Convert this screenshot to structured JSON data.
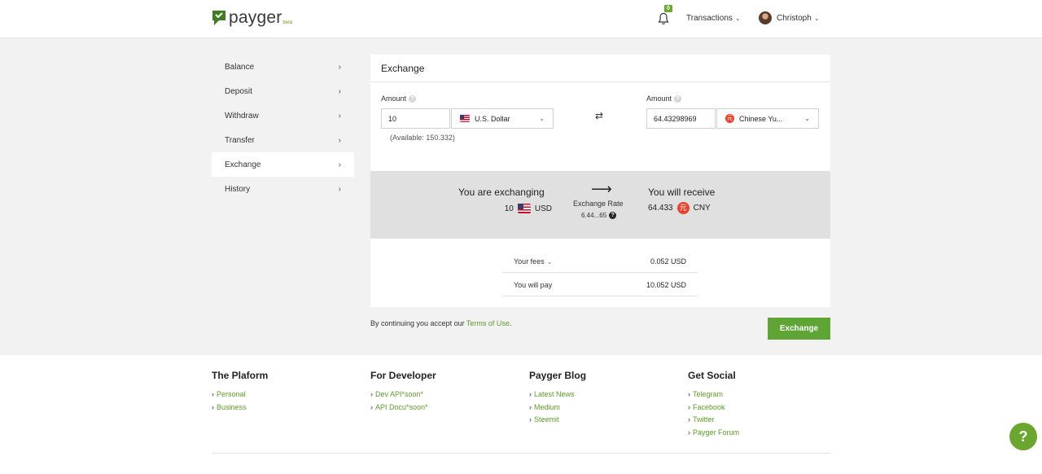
{
  "header": {
    "logo_text": "payger",
    "logo_beta": "beta",
    "notification_count": "0",
    "transactions_label": "Transactions",
    "user_name": "Christoph"
  },
  "sidebar": {
    "items": [
      {
        "label": "Balance"
      },
      {
        "label": "Deposit"
      },
      {
        "label": "Withdraw"
      },
      {
        "label": "Transfer"
      },
      {
        "label": "Exchange",
        "active": true
      },
      {
        "label": "History"
      }
    ]
  },
  "exchange": {
    "title": "Exchange",
    "from": {
      "amount_label": "Amount",
      "amount_value": "10",
      "currency": "U.S. Dollar",
      "available": "(Available: 150.332)"
    },
    "to": {
      "amount_label": "Amount",
      "amount_value": "64.43298969",
      "currency": "Chinese Yu..."
    },
    "summary": {
      "exchanging_title": "You are exchanging",
      "exchanging_amount": "10",
      "exchanging_code": "USD",
      "rate_label": "Exchange Rate",
      "rate_value": "6.44...65",
      "receive_title": "You will receive",
      "receive_amount": "64.433",
      "receive_code": "CNY"
    },
    "fees": {
      "fees_label": "Your fees",
      "fees_value": "0.052 USD",
      "pay_label": "You will pay",
      "pay_value": "10.052 USD"
    },
    "terms_prefix": "By continuing you accept our",
    "terms_link": "Terms of Use",
    "terms_suffix": ".",
    "button_label": "Exchange"
  },
  "footer": {
    "columns": [
      {
        "title": "The Plaform",
        "links": [
          "Personal",
          "Business"
        ]
      },
      {
        "title": "For Developer",
        "links": [
          "Dev API*soon*",
          "API Docu*soon*"
        ]
      },
      {
        "title": "Payger Blog",
        "links": [
          "Latest News",
          "Medium",
          "Steemit"
        ]
      },
      {
        "title": "Get Social",
        "links": [
          "Telegram",
          "Facebook",
          "Twitter",
          "Payger Forum"
        ]
      }
    ]
  },
  "icons": {
    "accent_color": "#5ea535",
    "cny_symbol": "元"
  }
}
